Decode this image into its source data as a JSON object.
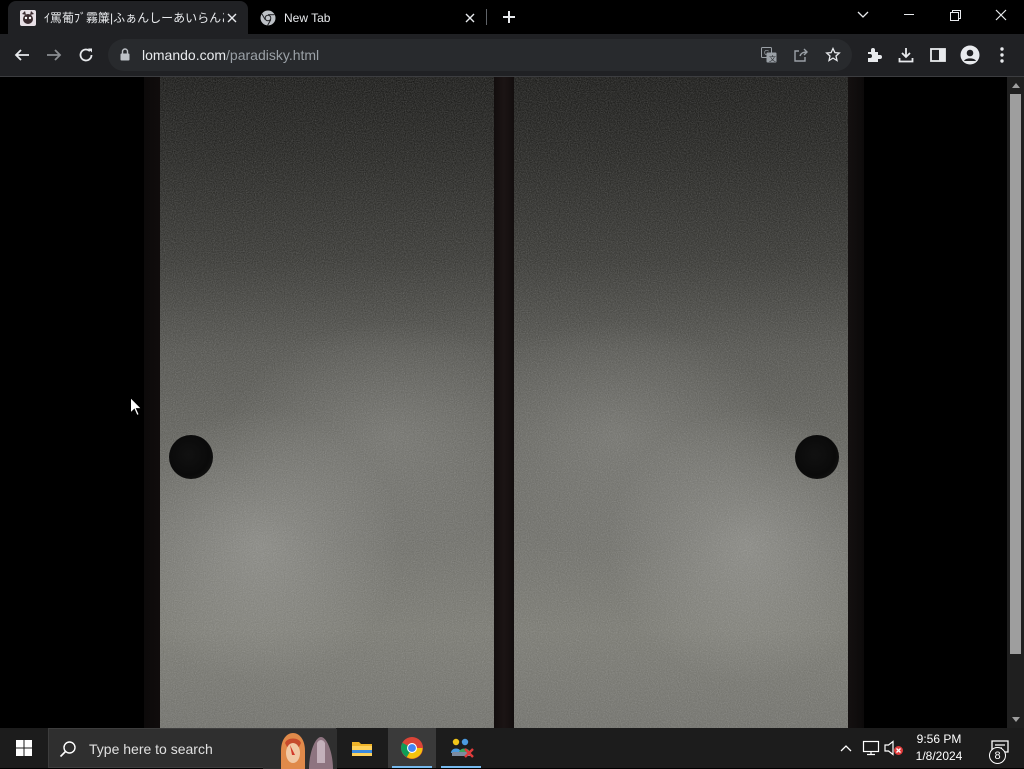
{
  "browser": {
    "tabs": [
      {
        "title": "ｲ罵葡ﾌﾞ霧簾|ふぁんしーあいらんどス",
        "active": true,
        "favicon": "site-favicon"
      },
      {
        "title": "New Tab",
        "active": false,
        "favicon": "chrome-icon"
      }
    ],
    "address_bar": {
      "domain": "lomando.com",
      "path": "/paradisky.html"
    },
    "toolbar_icons": [
      "back-icon",
      "forward-icon",
      "reload-icon",
      "lock-icon",
      "translate-icon",
      "share-icon",
      "bookmark-star-icon",
      "extensions-icon",
      "download-icon",
      "side-panel-icon",
      "profile-icon",
      "menu-icon"
    ]
  },
  "page": {
    "scene": "two sliding doors",
    "colors": {
      "door_light": "#77776f",
      "door_dark": "#0e0e0c",
      "frame": "#151111"
    }
  },
  "taskbar": {
    "search_placeholder": "Type here to search",
    "apps": [
      "file-explorer-icon",
      "chrome-icon",
      "network-app-icon"
    ],
    "clock": {
      "time": "9:56 PM",
      "date": "1/8/2024"
    },
    "notification_count": "8"
  }
}
